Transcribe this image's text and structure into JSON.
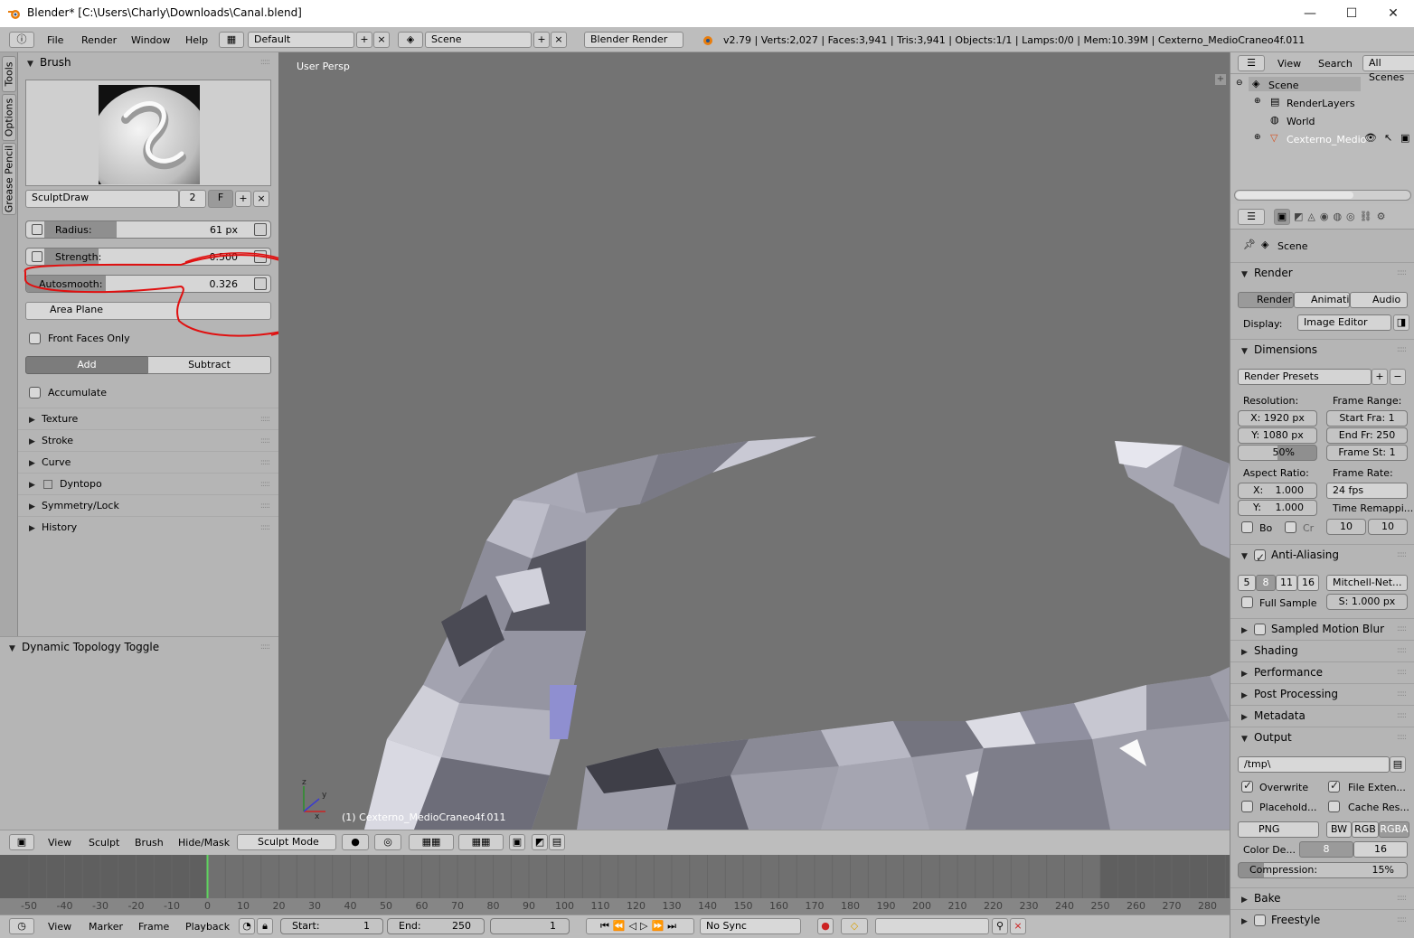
{
  "window": {
    "title": "Blender* [C:\\Users\\Charly\\Downloads\\Canal.blend]",
    "min": "—",
    "max": "☐",
    "close": "✕"
  },
  "infobar": {
    "menus": [
      "File",
      "Render",
      "Window",
      "Help"
    ],
    "layout": "Default",
    "scene": "Scene",
    "engine": "Blender Render",
    "stats": "v2.79 | Verts:2,027 | Faces:3,941 | Tris:3,941 | Objects:1/1 | Lamps:0/0 | Mem:10.39M | Cexterno_MedioCraneo4f.011"
  },
  "tool_tabs": [
    "Tools",
    "Options",
    "Grease Pencil"
  ],
  "brush": {
    "header": "Brush",
    "name": "SculptDraw",
    "users": "2",
    "fake": "F",
    "radius_label": "Radius:",
    "radius_value": "61 px",
    "radius_fill": 0.24,
    "strength_label": "Strength:",
    "strength_value": "0.500",
    "strength_fill": 0.5,
    "autosmooth_label": "Autosmooth:",
    "autosmooth_value": "0.326",
    "autosmooth_fill": 0.326,
    "plane": "Area Plane",
    "front_faces": "Front Faces Only",
    "add": "Add",
    "subtract": "Subtract",
    "accumulate": "Accumulate",
    "sections": [
      "Texture",
      "Stroke",
      "Curve",
      "Dyntopo",
      "Symmetry/Lock",
      "History"
    ]
  },
  "lower_panel": {
    "title": "Dynamic Topology Toggle"
  },
  "viewport": {
    "label": "User Persp",
    "object": "(1) Cexterno_MedioCraneo4f.011",
    "bg": "#737373",
    "annotation_color": "#e01010"
  },
  "viewport_header": {
    "menus": [
      "View",
      "Sculpt",
      "Brush",
      "Hide/Mask"
    ],
    "mode": "Sculpt Mode"
  },
  "timeline": {
    "ticks": [
      "-50",
      "-40",
      "-30",
      "-20",
      "-10",
      "0",
      "10",
      "20",
      "30",
      "40",
      "50",
      "60",
      "70",
      "80",
      "90",
      "100",
      "110",
      "120",
      "130",
      "140",
      "150",
      "160",
      "170",
      "180",
      "190",
      "200",
      "210",
      "220",
      "230",
      "240",
      "250",
      "260",
      "270",
      "280"
    ],
    "current_frame": 0
  },
  "timeline_header": {
    "menus": [
      "View",
      "Marker",
      "Frame",
      "Playback"
    ],
    "start_label": "Start:",
    "start": "1",
    "end_label": "End:",
    "end": "250",
    "frame": "1",
    "sync": "No Sync"
  },
  "outliner": {
    "menus": [
      "View",
      "Search"
    ],
    "filter": "All Scenes",
    "items": [
      "Scene",
      "RenderLayers",
      "World",
      "Cexterno_Medio"
    ]
  },
  "properties": {
    "context": "Scene",
    "render": {
      "header": "Render",
      "buttons": [
        "Render",
        "Animatio",
        "Audio"
      ],
      "display_label": "Display:",
      "display": "Image Editor"
    },
    "dimensions": {
      "header": "Dimensions",
      "presets": "Render Presets",
      "resolution_label": "Resolution:",
      "res_x": "X: 1920 px",
      "res_y": "Y: 1080 px",
      "res_pct": "50%",
      "frame_range_label": "Frame Range:",
      "start": "Start Fra: 1",
      "end": "End Fr: 250",
      "step": "Frame St: 1",
      "aspect_label": "Aspect Ratio:",
      "asp_x_l": "X:",
      "asp_x": "1.000",
      "asp_y_l": "Y:",
      "asp_y": "1.000",
      "frame_rate_label": "Frame Rate:",
      "fps": "24 fps",
      "time_remap": "Time Remappi...",
      "bo": "Bo",
      "cr": "Cr",
      "old": "10",
      "new": "10"
    },
    "aa": {
      "header": "Anti-Aliasing",
      "samples": [
        "5",
        "8",
        "11",
        "16"
      ],
      "filter": "Mitchell-Net...",
      "full_sample": "Full Sample",
      "size": "S: 1.000 px"
    },
    "collapsed": [
      "Sampled Motion Blur",
      "Shading",
      "Performance",
      "Post Processing",
      "Metadata"
    ],
    "output": {
      "header": "Output",
      "path": "/tmp\\",
      "overwrite": "Overwrite",
      "file_ext": "File Exten...",
      "placeholders": "Placehold...",
      "cache": "Cache Res...",
      "format": "PNG",
      "bw": "BW",
      "rgb": "RGB",
      "rgba": "RGBA",
      "color_depth_label": "Color De...",
      "depth8": "8",
      "depth16": "16",
      "compression": "Compression:",
      "compression_value": "15%"
    },
    "bottom": [
      "Bake",
      "Freestyle"
    ]
  }
}
